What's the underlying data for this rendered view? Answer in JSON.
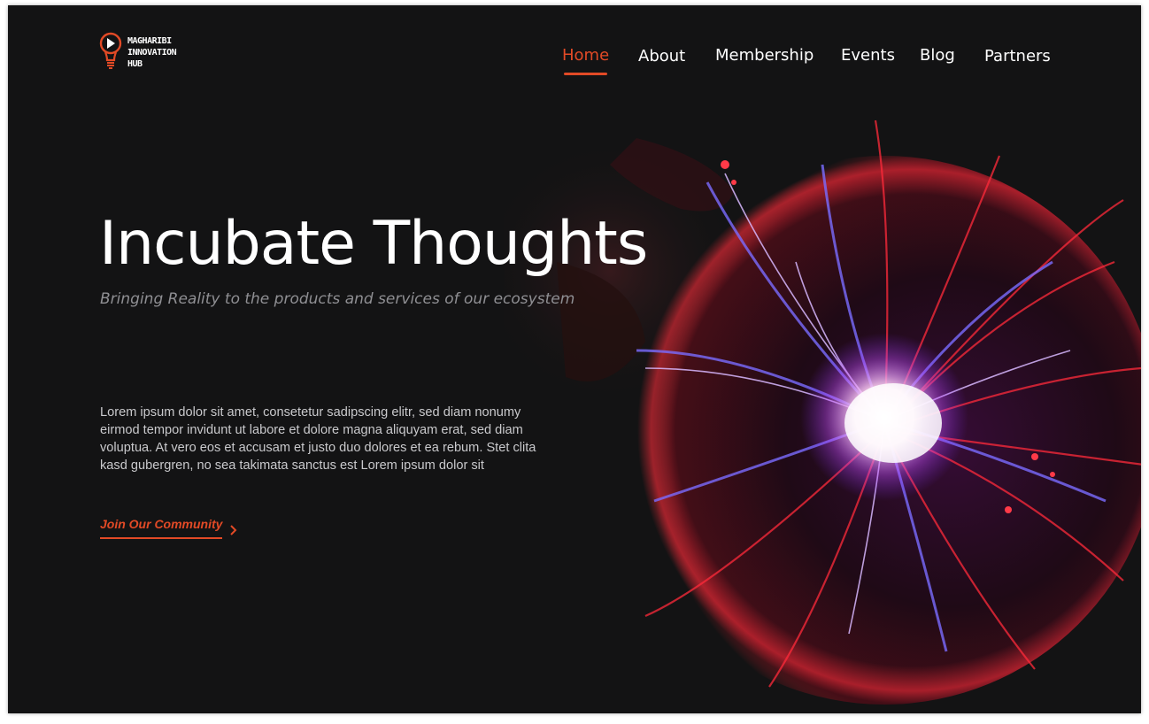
{
  "brand": {
    "logo_lines": [
      "MAGHARIBI",
      "INNOVATION",
      "HUB"
    ],
    "icon": "lightbulb-play-icon",
    "accent_color": "#e24a26"
  },
  "nav": {
    "items": [
      {
        "label": "Home",
        "active": true
      },
      {
        "label": "About",
        "active": false
      },
      {
        "label": "Membership",
        "active": false
      },
      {
        "label": "Events",
        "active": false
      },
      {
        "label": "Blog",
        "active": false
      },
      {
        "label": "Partners",
        "active": false
      }
    ]
  },
  "hero": {
    "title": "Incubate Thoughts",
    "subtitle": "Bringing Reality to the products and services of our ecosystem",
    "body": "Lorem ipsum dolor sit amet, consetetur sadipscing elitr, sed diam nonumy eirmod tempor invidunt ut labore et dolore magna aliquyam erat, sed diam voluptua. At vero eos et accusam et justo duo dolores et ea rebum. Stet clita kasd gubergren, no sea takimata sanctus est Lorem ipsum dolor sit",
    "cta_label": "Join Our Community",
    "cta_icon": "chevron-right-icon"
  },
  "colors": {
    "background": "#131314",
    "accent": "#e24a26",
    "text": "#ffffff",
    "muted": "#8f8f93"
  }
}
